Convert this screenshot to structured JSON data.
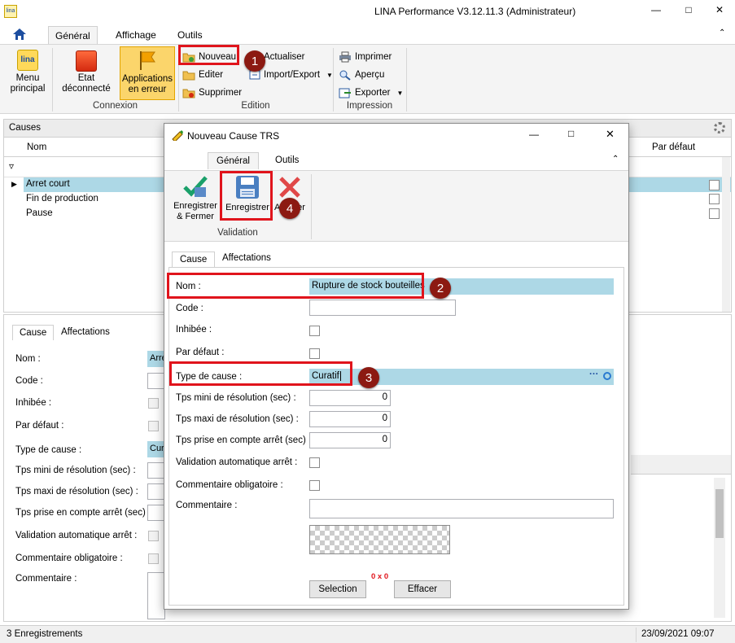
{
  "window": {
    "title": "LINA Performance  V3.12.11.3  (Administrateur)",
    "controls": [
      "—",
      "□",
      "✕"
    ]
  },
  "ribbon": {
    "tabs": [
      "Général",
      "Affichage",
      "Outils"
    ],
    "menu_principal": "Menu principal",
    "etat": "Etat déconnecté",
    "applications": "Applications en erreur",
    "connexion_label": "Connexion",
    "nouveau": "Nouveau",
    "editer": "Editer",
    "supprimer": "Supprimer",
    "actualiser": "Actualiser",
    "import_export": "Import/Export",
    "edition_label": "Edition",
    "imprimer": "Imprimer",
    "apercu": "Aperçu",
    "exporter": "Exporter",
    "impression_label": "Impression"
  },
  "causes_panel": {
    "title": "Causes",
    "col_nom": "Nom",
    "col_defaut": "Par défaut",
    "rows": [
      "Arret court",
      "Fin de production",
      "Pause"
    ]
  },
  "detail_panel": {
    "tabs": [
      "Cause",
      "Affectations"
    ],
    "labels": [
      "Nom :",
      "Code :",
      "Inhibée :",
      "Par défaut :",
      "Type de cause :",
      "Tps mini de résolution (sec) :",
      "Tps maxi de résolution (sec) :",
      "Tps prise en compte arrêt (sec) :",
      "Validation automatique arrêt :",
      "Commentaire obligatoire :",
      "Commentaire :"
    ],
    "nom_value": "Arre",
    "type_value": "Cur"
  },
  "dialog": {
    "title": "Nouveau Cause TRS",
    "tabs": [
      "Général",
      "Outils"
    ],
    "enregistrer_fermer": "Enregistrer & Fermer",
    "enregistrer": "Enregistrer",
    "annuler": "Annuler",
    "validation_label": "Validation",
    "inner_tabs": [
      "Cause",
      "Affectations"
    ],
    "labels": {
      "nom": "Nom :",
      "code": "Code :",
      "inhibee": "Inhibée :",
      "par_defaut": "Par défaut :",
      "type": "Type de cause :",
      "tps_mini": "Tps mini de résolution (sec) :",
      "tps_maxi": "Tps maxi de résolution (sec) :",
      "tps_prise": "Tps prise en compte arrêt (sec) :",
      "validation_auto": "Validation automatique arrêt :",
      "commentaire_oblig": "Commentaire obligatoire :",
      "commentaire": "Commentaire :"
    },
    "values": {
      "nom": "Rupture de stock bouteilles",
      "type": "Curatif",
      "tps_mini": "0",
      "tps_maxi": "0",
      "tps_prise": "0"
    },
    "image_size": "0 x 0",
    "selection": "Selection",
    "effacer": "Effacer"
  },
  "callouts": [
    "1",
    "2",
    "3",
    "4"
  ],
  "status": {
    "count": "3 Enregistrements",
    "datetime": "23/09/2021 09:07"
  },
  "colors": {
    "accent_selection": "#add8e6",
    "callout_red": "#e0141c",
    "badge": "#8c1a12"
  }
}
